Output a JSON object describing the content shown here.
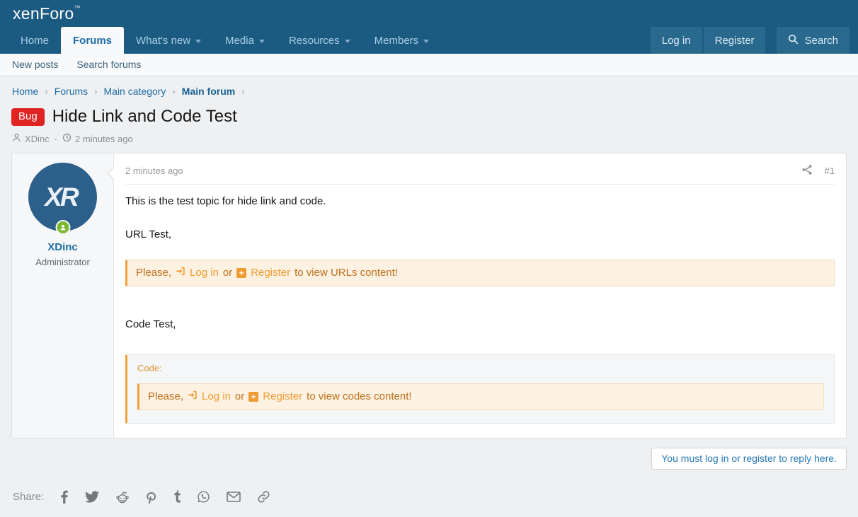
{
  "colors": {
    "header_bg": "#1c5b81",
    "header_button_bg": "#29698e",
    "link_blue": "#1d6da7",
    "subnav_link": "#3c617b",
    "bug_red": "#e02424",
    "notice_left_border": "#f0a13c",
    "notice_bg": "#fdf2e2",
    "notice_text": "#bf6f1d",
    "notice_link": "#ef9b33",
    "online_green": "#7cb92e",
    "avatar_bg": "#2d5f8b"
  },
  "header": {
    "logo_text": "xenForo",
    "logo_mark": "™",
    "nav": [
      {
        "label": "Home"
      },
      {
        "label": "Forums"
      },
      {
        "label": "What's new"
      },
      {
        "label": "Media"
      },
      {
        "label": "Resources"
      },
      {
        "label": "Members"
      }
    ],
    "login_label": "Log in",
    "register_label": "Register",
    "search_label": "Search"
  },
  "subnav": {
    "new_posts": "New posts",
    "search_forums": "Search forums"
  },
  "breadcrumb": {
    "separator": "›",
    "items": [
      {
        "label": "Home"
      },
      {
        "label": "Forums"
      },
      {
        "label": "Main category"
      },
      {
        "label": "Main forum"
      }
    ]
  },
  "thread": {
    "prefix": "Bug",
    "title": "Hide Link and Code Test",
    "author": "XDinc",
    "meta_separator": "·",
    "time": "2 minutes ago"
  },
  "post": {
    "time": "2 minutes ago",
    "number": "#1",
    "author": {
      "name": "XDinc",
      "role": "Administrator",
      "avatar_text": "XR"
    },
    "body": {
      "p1": "This is the test topic for hide link and code.",
      "p2": "URL Test,",
      "p3": "Code Test,",
      "code_label": "Code:",
      "plus_glyph": "+",
      "url_notice": {
        "prefix": "Please,",
        "login": "Log in",
        "or": "or",
        "register": "Register",
        "suffix": "to view URLs content!"
      },
      "code_notice": {
        "prefix": "Please,",
        "login": "Log in",
        "or": "or",
        "register": "Register",
        "suffix": "to view codes content!"
      }
    }
  },
  "reply_bar": {
    "message": "You must log in or register to reply here."
  },
  "share": {
    "label": "Share:",
    "icons": [
      "facebook",
      "twitter",
      "reddit",
      "pinterest",
      "tumblr",
      "whatsapp",
      "email",
      "link"
    ]
  }
}
